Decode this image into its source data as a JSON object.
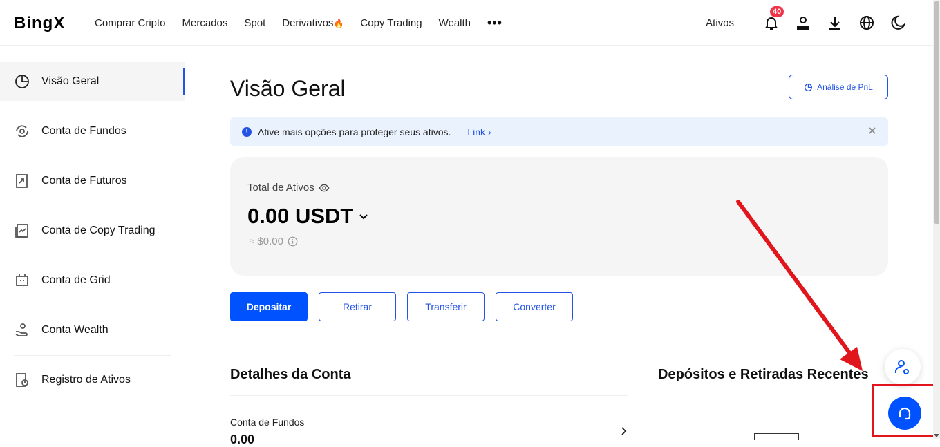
{
  "header": {
    "logo": "BingX",
    "nav": [
      "Comprar Cripto",
      "Mercados",
      "Spot",
      "Derivativos",
      "Copy Trading",
      "Wealth"
    ],
    "derivativos_flame": "🔥",
    "more": "•••",
    "ativos_label": "Ativos",
    "notification_count": "40",
    "icons": [
      "bell-icon",
      "user-icon",
      "download-icon",
      "globe-icon",
      "moon-icon"
    ]
  },
  "sidebar": {
    "items": [
      {
        "label": "Visão Geral",
        "icon": "pie-chart-icon",
        "active": true
      },
      {
        "label": "Conta de Fundos",
        "icon": "fund-cycle-icon"
      },
      {
        "label": "Conta de Futuros",
        "icon": "futures-chart-icon"
      },
      {
        "label": "Conta de Copy Trading",
        "icon": "copy-trading-icon"
      },
      {
        "label": "Conta de Grid",
        "icon": "grid-bot-icon"
      },
      {
        "label": "Conta Wealth",
        "icon": "wealth-hand-icon"
      },
      {
        "label": "Registro de Ativos",
        "icon": "asset-record-icon"
      }
    ]
  },
  "main": {
    "title": "Visão Geral",
    "pnl_button": "Análise de PnL",
    "alert": {
      "message": "Ative mais opções para proteger seus ativos.",
      "link": "Link ›"
    },
    "assets": {
      "label": "Total de Ativos",
      "value": "0.00",
      "currency": "USDT",
      "usd_equivalent": "≈ $0.00"
    },
    "actions": [
      "Depositar",
      "Retirar",
      "Transferir",
      "Converter"
    ],
    "details_title": "Detalhes da Conta",
    "recent_title": "Depósitos e Retiradas Recentes",
    "fund_account": {
      "label": "Conta de Fundos",
      "value": "0.00"
    }
  },
  "colors": {
    "accent": "#0052ff",
    "link_blue": "#2354e6",
    "badge_red": "#f0354a",
    "annotation_red": "#e0161c"
  }
}
